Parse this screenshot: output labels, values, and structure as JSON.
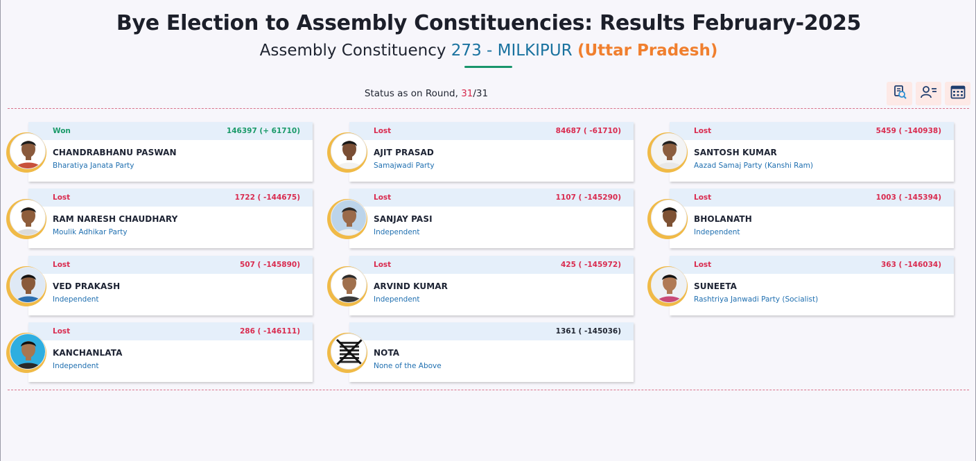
{
  "header": {
    "title": "Bye Election to Assembly Constituencies: Results February-2025",
    "subtitle_prefix": "Assembly Constituency ",
    "constituency": "273 - MILKIPUR",
    "state": "(Uttar Pradesh)"
  },
  "status": {
    "prefix": "Status as on Round, ",
    "current_round": "31",
    "total_rounds": "/31"
  },
  "toolbar": {
    "icons": [
      "chart-search-icon",
      "candidate-list-icon",
      "grid-view-icon"
    ]
  },
  "colors": {
    "won": "#1a9a69",
    "lost": "#d92b4f",
    "accent_blue": "#19729f",
    "accent_orange": "#f07f2e",
    "ring": "#f0ba47"
  },
  "candidates": [
    {
      "status": "Won",
      "votes": "146397 (+ 61710)",
      "name": "CHANDRABHANU PASWAN",
      "party": "Bharatiya Janata Party"
    },
    {
      "status": "Lost",
      "votes": "84687 ( -61710)",
      "name": "AJIT PRASAD",
      "party": "Samajwadi Party"
    },
    {
      "status": "Lost",
      "votes": "5459 ( -140938)",
      "name": "SANTOSH KUMAR",
      "party": "Aazad Samaj Party (Kanshi Ram)"
    },
    {
      "status": "Lost",
      "votes": "1722 ( -144675)",
      "name": "RAM NARESH CHAUDHARY",
      "party": "Moulik Adhikar Party"
    },
    {
      "status": "Lost",
      "votes": "1107 ( -145290)",
      "name": "SANJAY PASI",
      "party": "Independent"
    },
    {
      "status": "Lost",
      "votes": "1003 ( -145394)",
      "name": "BHOLANATH",
      "party": "Independent"
    },
    {
      "status": "Lost",
      "votes": "507 ( -145890)",
      "name": "VED PRAKASH",
      "party": "Independent"
    },
    {
      "status": "Lost",
      "votes": "425 ( -145972)",
      "name": "ARVIND KUMAR",
      "party": "Independent"
    },
    {
      "status": "Lost",
      "votes": "363 ( -146034)",
      "name": "SUNEETA",
      "party": "Rashtriya Janwadi Party (Socialist)"
    },
    {
      "status": "Lost",
      "votes": "286 ( -146111)",
      "name": "KANCHANLATA",
      "party": "Independent"
    },
    {
      "status": "",
      "votes": "1361 ( -145036)",
      "name": "NOTA",
      "party": "None of the Above"
    }
  ]
}
